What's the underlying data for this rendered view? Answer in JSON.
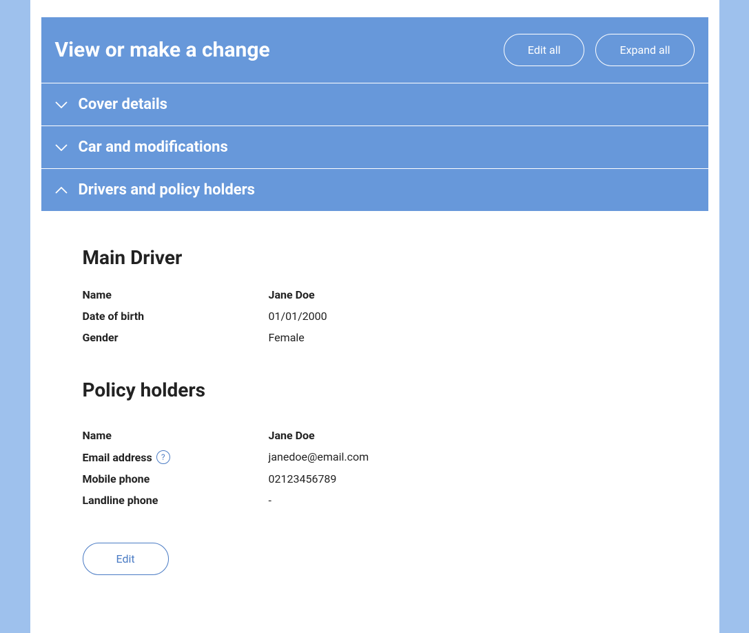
{
  "header": {
    "title": "View or make a change",
    "editAllLabel": "Edit all",
    "expandAllLabel": "Expand all"
  },
  "accordion": {
    "coverDetails": "Cover details",
    "carModifications": "Car and modifications",
    "driversPolicyHolders": "Drivers and policy holders"
  },
  "mainDriver": {
    "heading": "Main Driver",
    "nameLabel": "Name",
    "nameValue": "Jane Doe",
    "dobLabel": "Date of birth",
    "dobValue": "01/01/2000",
    "genderLabel": "Gender",
    "genderValue": "Female"
  },
  "policyHolders": {
    "heading": "Policy holders",
    "nameLabel": "Name",
    "nameValue": "Jane Doe",
    "emailLabel": "Email address",
    "emailValue": "janedoe@email.com",
    "mobileLabel": "Mobile phone",
    "mobileValue": "02123456789",
    "landlineLabel": "Landline phone",
    "landlineValue": "-",
    "helpIcon": "?",
    "editLabel": "Edit"
  }
}
